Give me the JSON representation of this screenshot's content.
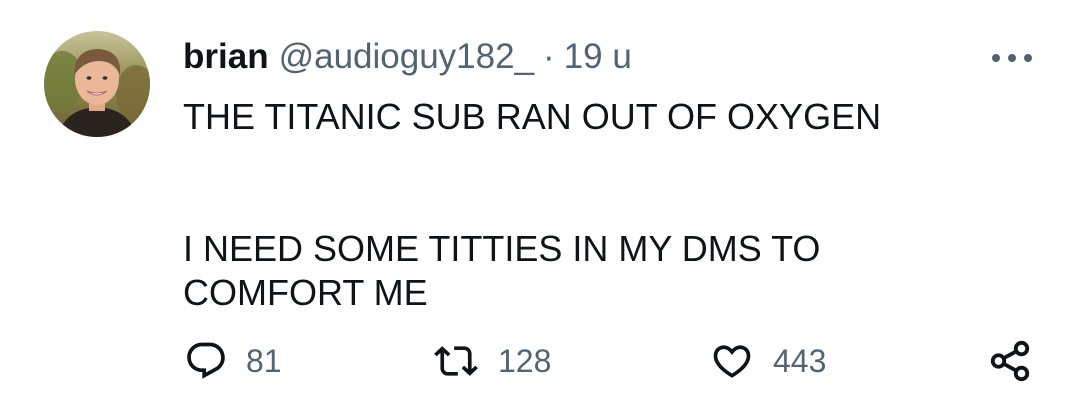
{
  "tweet": {
    "author": {
      "display_name": "brian",
      "handle": "@audioguy182_",
      "avatar": "profile-photo"
    },
    "separator": "·",
    "time": "19 u",
    "more_icon": "more-horizontal-icon",
    "text_lines": {
      "line1": "THE TITANIC SUB RAN OUT OF OXYGEN",
      "line2": "I NEED SOME TITTIES IN MY DMS TO",
      "line3": "COMFORT ME"
    },
    "actions": {
      "reply": {
        "icon": "reply-icon",
        "count": "81"
      },
      "retweet": {
        "icon": "retweet-icon",
        "count": "128"
      },
      "like": {
        "icon": "heart-icon",
        "count": "443"
      },
      "share": {
        "icon": "share-icon"
      }
    }
  },
  "colors": {
    "primary_text": "#0f1419",
    "secondary_text": "#536471",
    "background": "#ffffff"
  }
}
